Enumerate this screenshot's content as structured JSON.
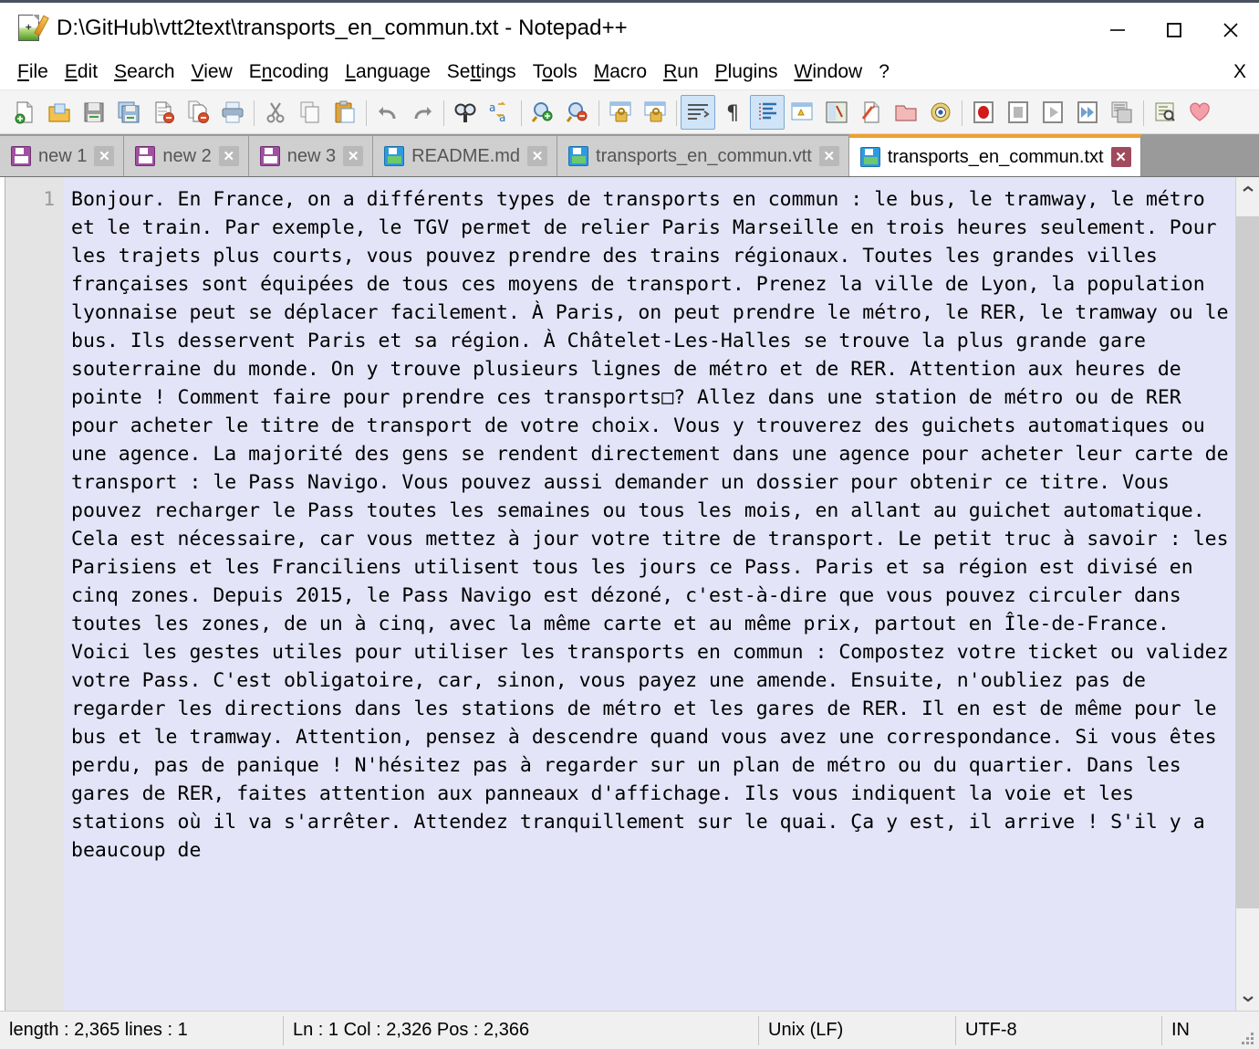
{
  "window": {
    "title": "D:\\GitHub\\vtt2text\\transports_en_commun.txt - Notepad++",
    "app_icon": "notepad-plus-plus-icon",
    "controls": {
      "minimize": "minimize-icon",
      "maximize": "maximize-icon",
      "close": "close-icon"
    }
  },
  "menu": {
    "items": [
      {
        "label": "File",
        "accel": "F"
      },
      {
        "label": "Edit",
        "accel": "E"
      },
      {
        "label": "Search",
        "accel": "S"
      },
      {
        "label": "View",
        "accel": "V"
      },
      {
        "label": "Encoding",
        "accel": "n"
      },
      {
        "label": "Language",
        "accel": "L"
      },
      {
        "label": "Settings",
        "accel": "t"
      },
      {
        "label": "Tools",
        "accel": "o"
      },
      {
        "label": "Macro",
        "accel": "M"
      },
      {
        "label": "Run",
        "accel": "R"
      },
      {
        "label": "Plugins",
        "accel": "P"
      },
      {
        "label": "Window",
        "accel": "W"
      },
      {
        "label": "?",
        "accel": "?"
      }
    ],
    "close_document_label": "X"
  },
  "toolbar": {
    "buttons": [
      {
        "name": "new-file-icon",
        "title": "New"
      },
      {
        "name": "open-file-icon",
        "title": "Open"
      },
      {
        "name": "save-icon",
        "title": "Save"
      },
      {
        "name": "save-all-icon",
        "title": "Save All"
      },
      {
        "name": "close-file-icon",
        "title": "Close"
      },
      {
        "name": "close-all-files-icon",
        "title": "Close All"
      },
      {
        "name": "print-icon",
        "title": "Print"
      },
      {
        "name": "cut-icon",
        "title": "Cut"
      },
      {
        "name": "copy-icon",
        "title": "Copy"
      },
      {
        "name": "paste-icon",
        "title": "Paste"
      },
      {
        "name": "undo-icon",
        "title": "Undo"
      },
      {
        "name": "redo-icon",
        "title": "Redo"
      },
      {
        "name": "find-icon",
        "title": "Find"
      },
      {
        "name": "replace-icon",
        "title": "Replace"
      },
      {
        "name": "zoom-in-icon",
        "title": "Zoom In"
      },
      {
        "name": "zoom-out-icon",
        "title": "Zoom Out"
      },
      {
        "name": "sync-vertical-scroll-icon",
        "title": "Synchronize Vertical Scrolling"
      },
      {
        "name": "sync-horizontal-scroll-icon",
        "title": "Synchronize Horizontal Scrolling"
      },
      {
        "name": "word-wrap-icon",
        "title": "Word wrap",
        "active": true
      },
      {
        "name": "show-all-characters-icon",
        "title": "Show All Characters"
      },
      {
        "name": "indent-guide-icon",
        "title": "Show Indent Guide",
        "active": true
      },
      {
        "name": "user-defined-dialog-icon",
        "title": "User-Defined Dialogue"
      },
      {
        "name": "document-map-icon",
        "title": "Document Map"
      },
      {
        "name": "function-list-icon",
        "title": "Function List"
      },
      {
        "name": "folder-as-workspace-icon",
        "title": "Folder as Workspace"
      },
      {
        "name": "monitoring-icon",
        "title": "Monitoring"
      },
      {
        "name": "record-macro-icon",
        "title": "Start Recording"
      },
      {
        "name": "stop-macro-icon",
        "title": "Stop Recording"
      },
      {
        "name": "play-macro-icon",
        "title": "Playback"
      },
      {
        "name": "run-macro-multiple-icon",
        "title": "Run a Macro Multiple Times"
      },
      {
        "name": "save-macro-icon",
        "title": "Save Current Recorded Macro"
      },
      {
        "name": "run-dialog-icon",
        "title": "Run"
      },
      {
        "name": "donate-icon",
        "title": "Donate"
      }
    ]
  },
  "tabs": [
    {
      "label": "new 1",
      "icon": "unsaved-disk-icon",
      "icon_color": "purple",
      "active": false
    },
    {
      "label": "new 2",
      "icon": "unsaved-disk-icon",
      "icon_color": "purple",
      "active": false
    },
    {
      "label": "new 3",
      "icon": "unsaved-disk-icon",
      "icon_color": "purple",
      "active": false
    },
    {
      "label": "README.md",
      "icon": "saved-disk-icon",
      "icon_color": "blue",
      "active": false
    },
    {
      "label": "transports_en_commun.vtt",
      "icon": "saved-disk-icon",
      "icon_color": "blue",
      "active": false
    },
    {
      "label": "transports_en_commun.txt",
      "icon": "saved-disk-icon",
      "icon_color": "green",
      "active": true
    }
  ],
  "tab_close_glyph": "✕",
  "editor": {
    "line_numbers": "1",
    "selection_color": "#e4e4f8",
    "content": "Bonjour. En France, on a différents types de transports en commun : le bus, le tramway, le métro et le train. Par exemple, le TGV permet de relier Paris Marseille en trois heures seulement. Pour les trajets plus courts, vous pouvez prendre des trains régionaux. Toutes les grandes villes françaises sont équipées de tous ces moyens de transport. Prenez la ville de Lyon, la population lyonnaise peut se déplacer facilement. À Paris, on peut prendre le métro, le RER, le tramway ou le bus. Ils desservent Paris et sa région. À Châtelet-Les-Halles se trouve la plus grande gare souterraine du monde. On y trouve plusieurs lignes de métro et de RER. Attention aux heures de pointe ! Comment faire pour prendre ces transports□? Allez dans une station de métro ou de RER pour acheter le titre de transport de votre choix. Vous y trouverez des guichets automatiques ou une agence. La majorité des gens se rendent directement dans une agence pour acheter leur carte de transport : le Pass Navigo. Vous pouvez aussi demander un dossier pour obtenir ce titre. Vous pouvez recharger le Pass toutes les semaines ou tous les mois, en allant au guichet automatique. Cela est nécessaire, car vous mettez à jour votre titre de transport. Le petit truc à savoir : les Parisiens et les Franciliens utilisent tous les jours ce Pass. Paris et sa région est divisé en cinq zones. Depuis 2015, le Pass Navigo est dézoné, c'est-à-dire que vous pouvez circuler dans toutes les zones, de un à cinq, avec la même carte et au même prix, partout en Île-de-France. Voici les gestes utiles pour utiliser les transports en commun : Compostez votre ticket ou validez votre Pass. C'est obligatoire, car, sinon, vous payez une amende. Ensuite, n'oubliez pas de regarder les directions dans les stations de métro et les gares de RER. Il en est de même pour le bus et le tramway. Attention, pensez à descendre quand vous avez une correspondance. Si vous êtes perdu, pas de panique ! N'hésitez pas à regarder sur un plan de métro ou du quartier. Dans les gares de RER, faites attention aux panneaux d'affichage. Ils vous indiquent la voie et les stations où il va s'arrêter. Attendez tranquillement sur le quai. Ça y est, il arrive ! S'il y a beaucoup de"
  },
  "scrollbar": {
    "up_arrow": "chevron-up-icon",
    "down_arrow": "chevron-down-icon"
  },
  "statusbar": {
    "length_lines": "length : 2,365    lines : 1",
    "caret": "Ln : 1    Col : 2,326    Pos : 2,366",
    "eol": "Unix (LF)",
    "encoding": "UTF-8",
    "insert_mode": "IN"
  }
}
